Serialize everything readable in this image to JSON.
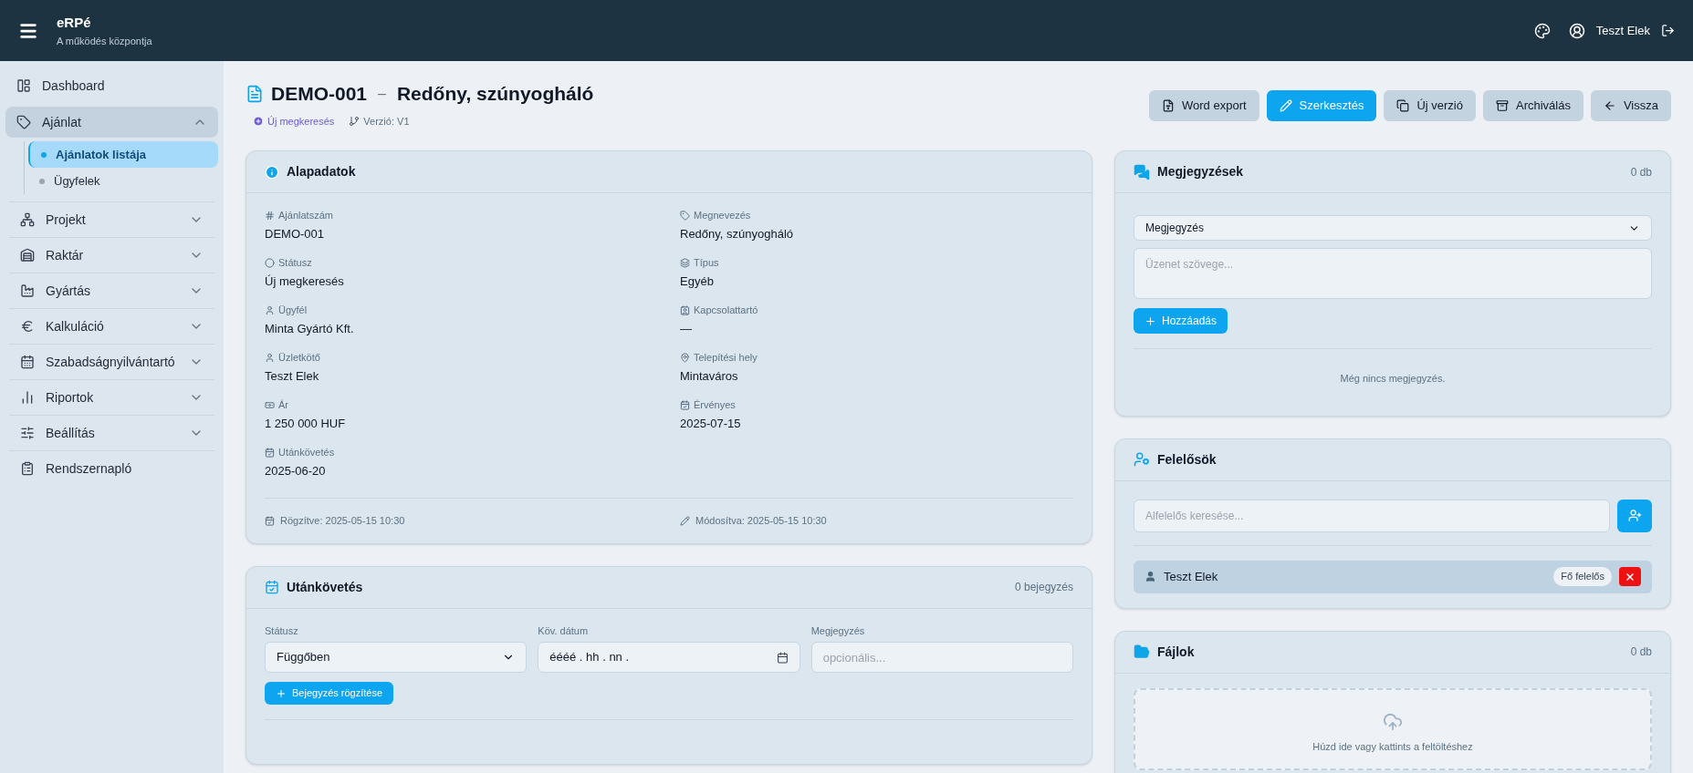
{
  "topbar": {
    "app_name": "eRPé",
    "tagline": "A működés központja",
    "user": "Teszt Elek"
  },
  "sidebar": {
    "items": [
      {
        "label": "Dashboard",
        "kind": "link",
        "selected": false
      },
      {
        "label": "Ajánlat",
        "kind": "group",
        "selected": true,
        "expanded": true,
        "children": [
          {
            "label": "Ajánlatok listája",
            "selected": true
          },
          {
            "label": "Ügyfelek",
            "selected": false
          }
        ]
      },
      {
        "label": "Projekt",
        "kind": "group",
        "selected": false,
        "expanded": false
      },
      {
        "label": "Raktár",
        "kind": "group",
        "selected": false,
        "expanded": false
      },
      {
        "label": "Gyártás",
        "kind": "group",
        "selected": false,
        "expanded": false
      },
      {
        "label": "Kalkuláció",
        "kind": "group",
        "selected": false,
        "expanded": false
      },
      {
        "label": "Szabadságnyilvántartó",
        "kind": "group",
        "selected": false,
        "expanded": false
      },
      {
        "label": "Riportok",
        "kind": "group",
        "selected": false,
        "expanded": false
      },
      {
        "label": "Beállítás",
        "kind": "group",
        "selected": false,
        "expanded": false
      },
      {
        "label": "Rendszernapló",
        "kind": "link",
        "selected": false
      }
    ]
  },
  "page": {
    "code": "DEMO-001",
    "separator": "–",
    "title": "Redőny, szúnyogháló",
    "status_badge": "Új megkeresés",
    "version": "Verzió: V1",
    "buttons": [
      {
        "label": "Word export",
        "kind": "secondary"
      },
      {
        "label": "Szerkesztés",
        "kind": "primary"
      },
      {
        "label": "Új verzió",
        "kind": "secondary"
      },
      {
        "label": "Archiválás",
        "kind": "secondary"
      },
      {
        "label": "Vissza",
        "kind": "secondary"
      }
    ]
  },
  "basic_data": {
    "title": "Alapadatok",
    "fields": [
      {
        "label": "Ajánlatszám",
        "value": "DEMO-001"
      },
      {
        "label": "Megnevezés",
        "value": "Redőny, szúnyogháló"
      },
      {
        "label": "Státusz",
        "value": "Új megkeresés"
      },
      {
        "label": "Típus",
        "value": "Egyéb"
      },
      {
        "label": "Ügyfél",
        "value": "Minta Gyártó Kft."
      },
      {
        "label": "Kapcsolattartó",
        "value": "—"
      },
      {
        "label": "Üzletkötő",
        "value": "Teszt Elek"
      },
      {
        "label": "Telepítési hely",
        "value": "Mintaváros"
      },
      {
        "label": "Ár",
        "value": "1 250 000 HUF"
      },
      {
        "label": "Érvényes",
        "value": "2025-07-15"
      },
      {
        "label": "Utánkövetés",
        "value": "2025-06-20"
      }
    ],
    "created": "Rögzítve: 2025-05-15 10:30",
    "modified": "Módosítva: 2025-05-15 10:30"
  },
  "follow_up": {
    "title": "Utánkövetés",
    "count": "0 bejegyzés",
    "status_label": "Státusz",
    "status_value": "Függőben",
    "date_label": "Köv. dátum",
    "date_placeholder": "éééé . hh . nn .",
    "note_label": "Megjegyzés",
    "note_placeholder": "opcionális...",
    "submit": "Bejegyzés rögzítése"
  },
  "comments": {
    "title": "Megjegyzések",
    "count": "0 db",
    "type_value": "Megjegyzés",
    "message_placeholder": "Üzenet szövege...",
    "add": "Hozzáadás",
    "empty": "Még nincs megjegyzés."
  },
  "responsibles": {
    "title": "Felelősök",
    "search_placeholder": "Alfelelős keresése...",
    "people": [
      {
        "name": "Teszt Elek",
        "badge": "Fő felelős"
      }
    ]
  },
  "files": {
    "title": "Fájlok",
    "count": "0 db",
    "drop_text": "Húzd ide vagy kattints a feltöltéshez"
  }
}
